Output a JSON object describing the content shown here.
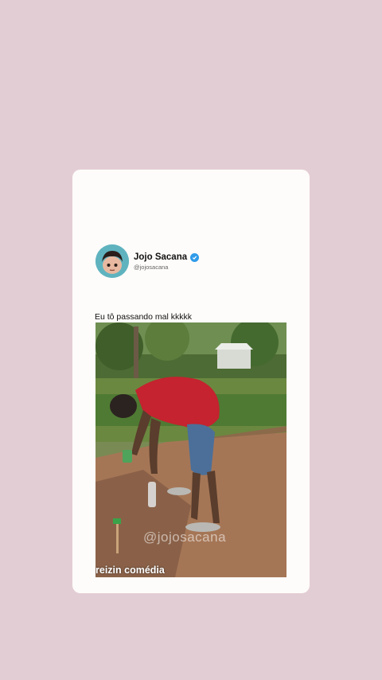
{
  "post": {
    "display_name": "Jojo Sacana",
    "handle": "@jojosacana",
    "verified_icon": "verified-badge-icon",
    "text": "Eu tô passando mal kkkkk",
    "media": {
      "watermark": "@jojosacana",
      "caption": "reizin comédia"
    }
  },
  "colors": {
    "background": "#e3cdd4",
    "card": "#fefcfa",
    "verified": "#2f9be9",
    "avatar_bg": "#5fb3bf"
  }
}
